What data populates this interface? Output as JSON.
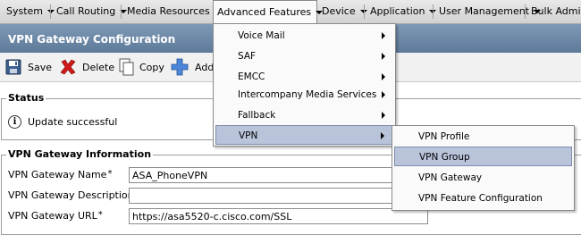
{
  "menubar": {
    "items": [
      {
        "label": "System"
      },
      {
        "label": "Call Routing"
      },
      {
        "label": "Media Resources"
      },
      {
        "label": "Advanced Features"
      },
      {
        "label": "Device"
      },
      {
        "label": "Application"
      },
      {
        "label": "User Management"
      },
      {
        "label": "Bulk Adminis"
      }
    ],
    "open_index": 3
  },
  "page": {
    "title": "VPN Gateway Configuration"
  },
  "toolbar": {
    "save_label": "Save",
    "delete_label": "Delete",
    "copy_label": "Copy",
    "add_label": "Add"
  },
  "status": {
    "legend": "Status",
    "message": "Update successful"
  },
  "info": {
    "legend": "VPN Gateway Information",
    "name_label": "VPN Gateway Name",
    "name_value": "ASA_PhoneVPN",
    "description_label": "VPN Gateway Description",
    "description_value": "",
    "url_label": "VPN Gateway URL",
    "url_value": "https://asa5520-c.cisco.com/SSL",
    "required_mark": "*"
  },
  "advanced_menu": {
    "items": [
      {
        "label": "Voice Mail"
      },
      {
        "label": "SAF"
      },
      {
        "label": "EMCC"
      },
      {
        "label": "Intercompany Media Services"
      },
      {
        "label": "Fallback"
      },
      {
        "label": "VPN"
      }
    ],
    "active_index": 5
  },
  "vpn_submenu": {
    "items": [
      {
        "label": "VPN Profile"
      },
      {
        "label": "VPN Group"
      },
      {
        "label": "VPN Gateway"
      },
      {
        "label": "VPN Feature Configuration"
      }
    ],
    "active_index": 1
  },
  "colors": {
    "title_bar": "#6b87a6",
    "highlight": "#b9c3da",
    "delete_icon": "#d11a1a",
    "add_icon": "#2f6fd0"
  },
  "icons": {
    "save": "floppy-disk-icon",
    "delete": "red-x-icon",
    "copy": "copy-document-icon",
    "add": "blue-plus-icon",
    "status": "info-icon"
  }
}
